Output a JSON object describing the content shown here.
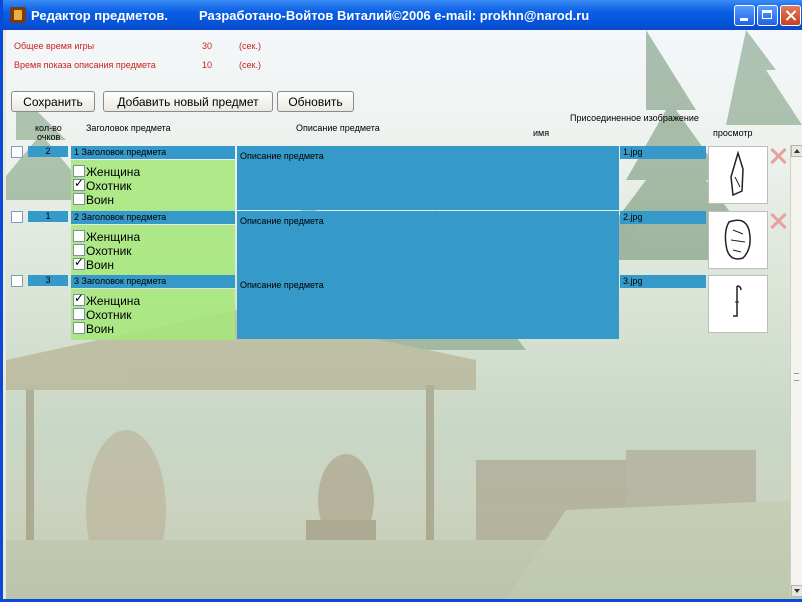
{
  "window": {
    "title": "Редактор предметов.",
    "credit": "Разработано-Войтов Виталий©2006 e-mail:  prokhn@narod.ru"
  },
  "info": {
    "game_time_label": "Общее время игры",
    "game_time_value": "30",
    "game_time_unit": "(сек.)",
    "show_time_label": "Время показа описания предмета",
    "show_time_value": "10",
    "show_time_unit": "(сек.)"
  },
  "toolbar": {
    "save_label": "Сохранить",
    "add_label": "Добавить новый предмет",
    "refresh_label": "Обновить"
  },
  "headers": {
    "score_label_1": "кол-во",
    "score_label_2": "очков",
    "title_label": "Заголовок предмета",
    "desc_label": "Описание предмета",
    "attached_label": "Присоединенное изображение",
    "name_label": "имя",
    "preview_label": "просмотр"
  },
  "items": [
    {
      "score": "2",
      "title": "1 Заголовок предмета",
      "description": "Описание предмета",
      "image": "1.jpg",
      "roles": [
        {
          "label": "Женщина",
          "checked": false
        },
        {
          "label": "Охотник",
          "checked": true
        },
        {
          "label": "Воин",
          "checked": false
        }
      ]
    },
    {
      "score": "1",
      "title": "2 Заголовок предмета",
      "description": "Описание предмета",
      "image": "2.jpg",
      "roles": [
        {
          "label": "Женщина",
          "checked": false
        },
        {
          "label": "Охотник",
          "checked": false
        },
        {
          "label": "Воин",
          "checked": true
        }
      ]
    },
    {
      "score": "3",
      "title": "3 Заголовок предмета",
      "description": "Описание предмета",
      "image": "3.jpg",
      "roles": [
        {
          "label": "Женщина",
          "checked": true
        },
        {
          "label": "Охотник",
          "checked": false
        },
        {
          "label": "Воин",
          "checked": false
        }
      ]
    }
  ],
  "colors": {
    "row_blue": "#3599c9",
    "roles_green": "#a4e878",
    "info_red": "#c8241a",
    "titlebar_blue": "#0553d6"
  }
}
